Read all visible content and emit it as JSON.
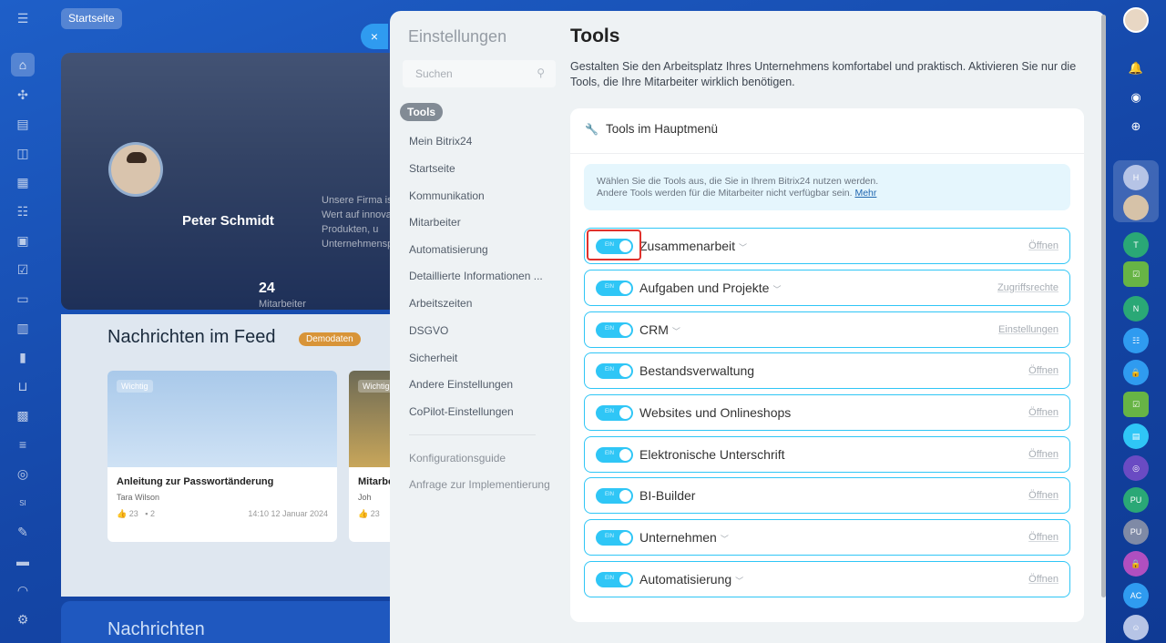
{
  "topbar": {
    "home_label": "Startseite"
  },
  "hero": {
    "user_name": "Peter Schmidt",
    "description": "Unsere Firma is Wert auf innova an Produkten, u Unternehmensp",
    "employee_count": "24",
    "employee_label": "Mitarbeiter"
  },
  "feed": {
    "title": "Nachrichten im Feed",
    "badge": "Demodaten",
    "cards": [
      {
        "tag": "Wichtig",
        "title": "Anleitung zur Passwortänderung",
        "author": "Tara Wilson",
        "likes": "23",
        "comments": "2",
        "date": "14:10 12 Januar 2024"
      },
      {
        "tag": "Wichtig",
        "title": "Mitarbe",
        "author": "Joh",
        "likes": "23"
      }
    ],
    "bottom_title": "Nachrichten"
  },
  "close_label": "×",
  "settings": {
    "header": "Einstellungen",
    "search_placeholder": "Suchen",
    "nav_items": [
      "Tools",
      "Mein Bitrix24",
      "Startseite",
      "Kommunikation",
      "Mitarbeiter",
      "Automatisierung",
      "Detaillierte Informationen ...",
      "Arbeitszeiten",
      "DSGVO",
      "Sicherheit",
      "Andere Einstellungen",
      "CoPilot-Einstellungen"
    ],
    "nav_extra": [
      "Konfigurationsguide",
      "Anfrage zur Implementierung"
    ]
  },
  "content": {
    "title": "Tools",
    "description": "Gestalten Sie den Arbeitsplatz Ihres Unternehmens komfortabel und praktisch. Aktivieren Sie nur die Tools, die Ihre Mitarbeiter wirklich benötigen.",
    "card_title": "Tools im Hauptmenü",
    "info_line1": "Wählen Sie die Tools aus, die Sie in Ihrem Bitrix24 nutzen werden.",
    "info_line2": "Andere Tools werden für die Mitarbeiter nicht verfügbar sein.",
    "info_link": "Mehr",
    "toggle_label": "EIN",
    "tools": [
      {
        "name": "Zusammenarbeit",
        "link": "Öffnen",
        "expandable": true
      },
      {
        "name": "Aufgaben und Projekte",
        "link": "Zugriffsrechte",
        "expandable": true
      },
      {
        "name": "CRM",
        "link": "Einstellungen",
        "expandable": true
      },
      {
        "name": "Bestandsverwaltung",
        "link": "Öffnen",
        "expandable": false
      },
      {
        "name": "Websites und Onlineshops",
        "link": "Öffnen",
        "expandable": false
      },
      {
        "name": "Elektronische Unterschrift",
        "link": "Öffnen",
        "expandable": false
      },
      {
        "name": "BI-Builder",
        "link": "Öffnen",
        "expandable": false
      },
      {
        "name": "Unternehmen",
        "link": "Öffnen",
        "expandable": true
      },
      {
        "name": "Automatisierung",
        "link": "Öffnen",
        "expandable": true
      }
    ]
  },
  "right_rail": {
    "avatars": [
      "H",
      "T",
      "N",
      "PU",
      "PU",
      "AC"
    ]
  },
  "colors": {
    "accent": "#2fc6f6",
    "highlight": "#e0312c",
    "brand": "#1e5fc8"
  }
}
